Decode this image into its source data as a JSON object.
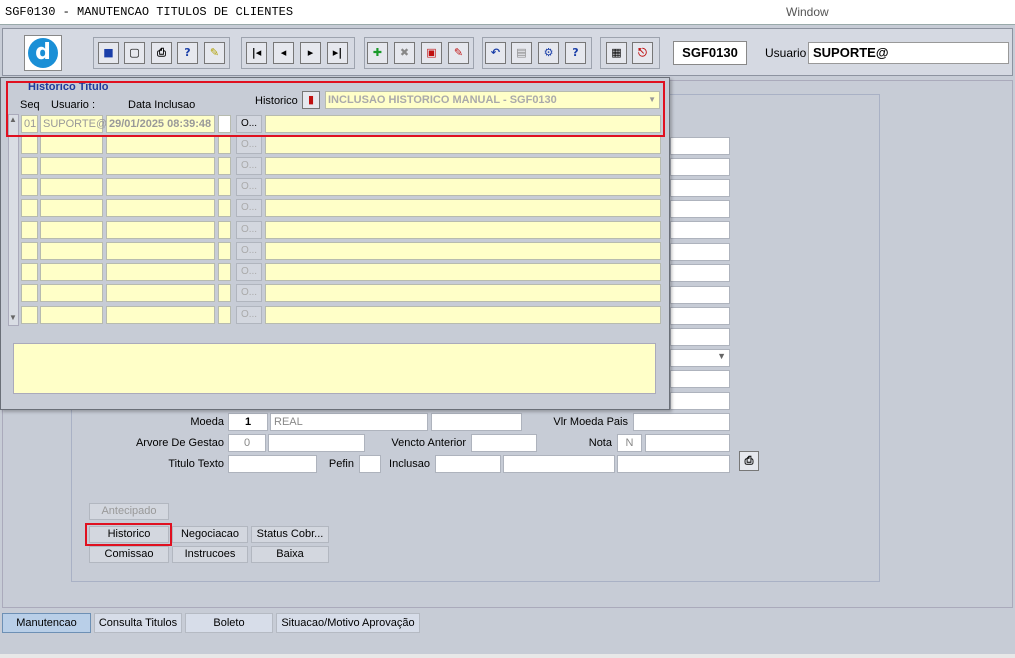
{
  "window": {
    "title": "SGF0130 - MANUTENCAO TITULOS DE CLIENTES",
    "menu_window": "Window"
  },
  "toolbar": {
    "program": "SGF0130",
    "usuario_label": "Usuario",
    "usuario_value": "SUPORTE@"
  },
  "form": {
    "moeda_label": "Moeda",
    "moeda_code": "1",
    "moeda_name": "REAL",
    "vlr_moeda_pais_label": "Vlr Moeda Pais",
    "arvore_label": "Arvore De Gestao",
    "arvore_value": "0",
    "vencto_anterior_label": "Vencto Anterior",
    "nota_label": "Nota",
    "nota_value": "N",
    "titulo_texto_label": "Titulo Texto",
    "pefin_label": "Pefin",
    "inclusao_label": "Inclusao"
  },
  "buttons": {
    "antecipado": "Antecipado",
    "historico": "Historico",
    "negociacao": "Negociacao",
    "status_cobr": "Status Cobr...",
    "comissao": "Comissao",
    "instrucoes": "Instrucoes",
    "baixa": "Baixa"
  },
  "tabs": [
    "Manutencao",
    "Consulta Titulos",
    "Boleto",
    "Situacao/Motivo Aprovação"
  ],
  "popup": {
    "title": "Historico Titulo",
    "col_seq": "Seq",
    "col_usuario": "Usuario :",
    "col_data": "Data Inclusao",
    "historico_label": "Historico",
    "historico_value": "INCLUSAO HISTORICO MANUAL - SGF0130",
    "row1": {
      "seq": "01",
      "usuario": "SUPORTE@",
      "data": "29/01/2025 08:39:48",
      "obtn": "O..."
    },
    "obtn_label": "O..."
  }
}
